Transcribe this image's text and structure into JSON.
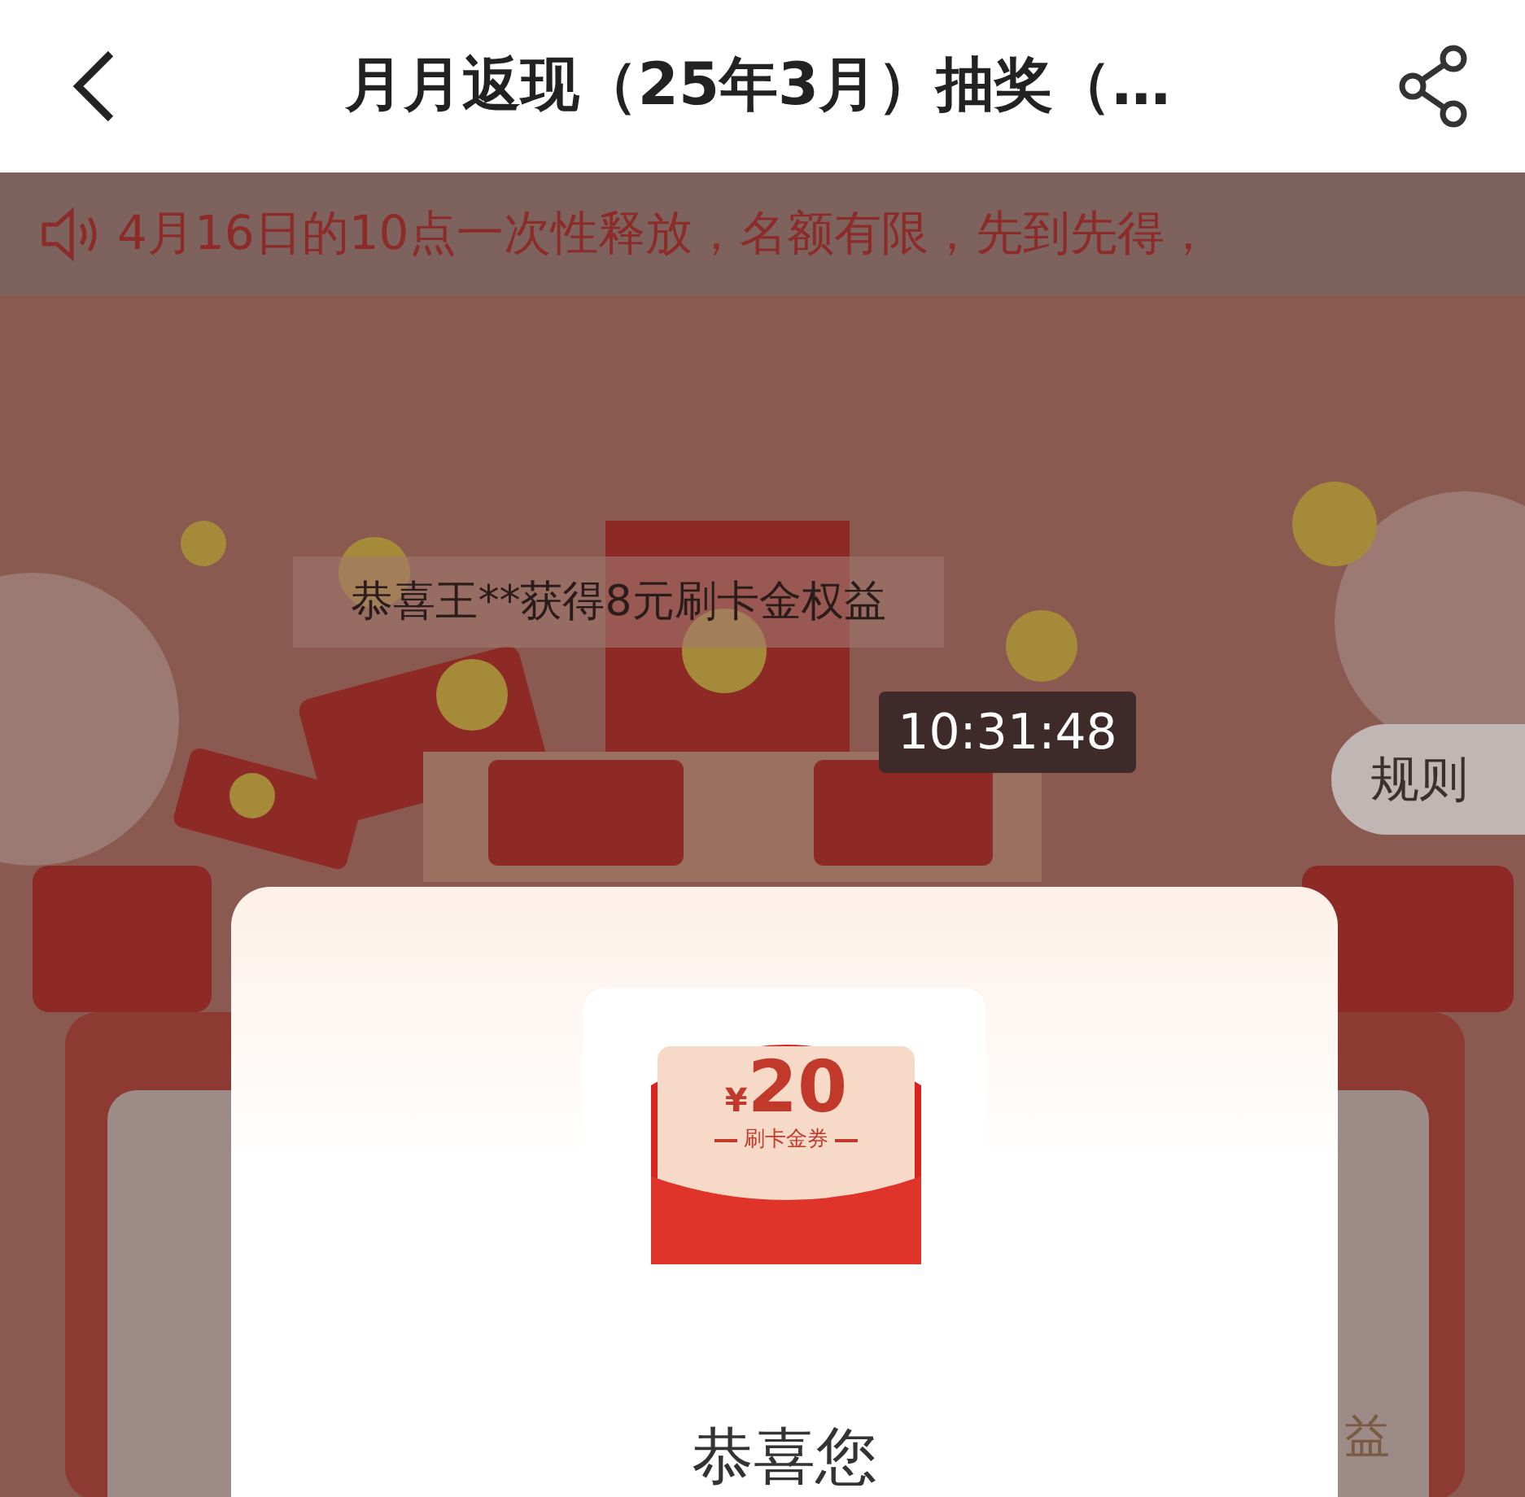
{
  "header": {
    "title": "月月返现（25年3月）抽奖（…"
  },
  "notice": {
    "text": "4月16日的10点一次性释放，名额有限，先到先得，"
  },
  "broadcast": {
    "text": "恭喜王**获得8元刷卡金权益"
  },
  "countdown": {
    "time": "10:31:48"
  },
  "rules_button": {
    "label": "规则"
  },
  "background_card": {
    "text": "益"
  },
  "modal": {
    "voucher": {
      "currency": "¥",
      "amount": "20",
      "label": "刷卡金券"
    },
    "heading": "恭喜您"
  }
}
